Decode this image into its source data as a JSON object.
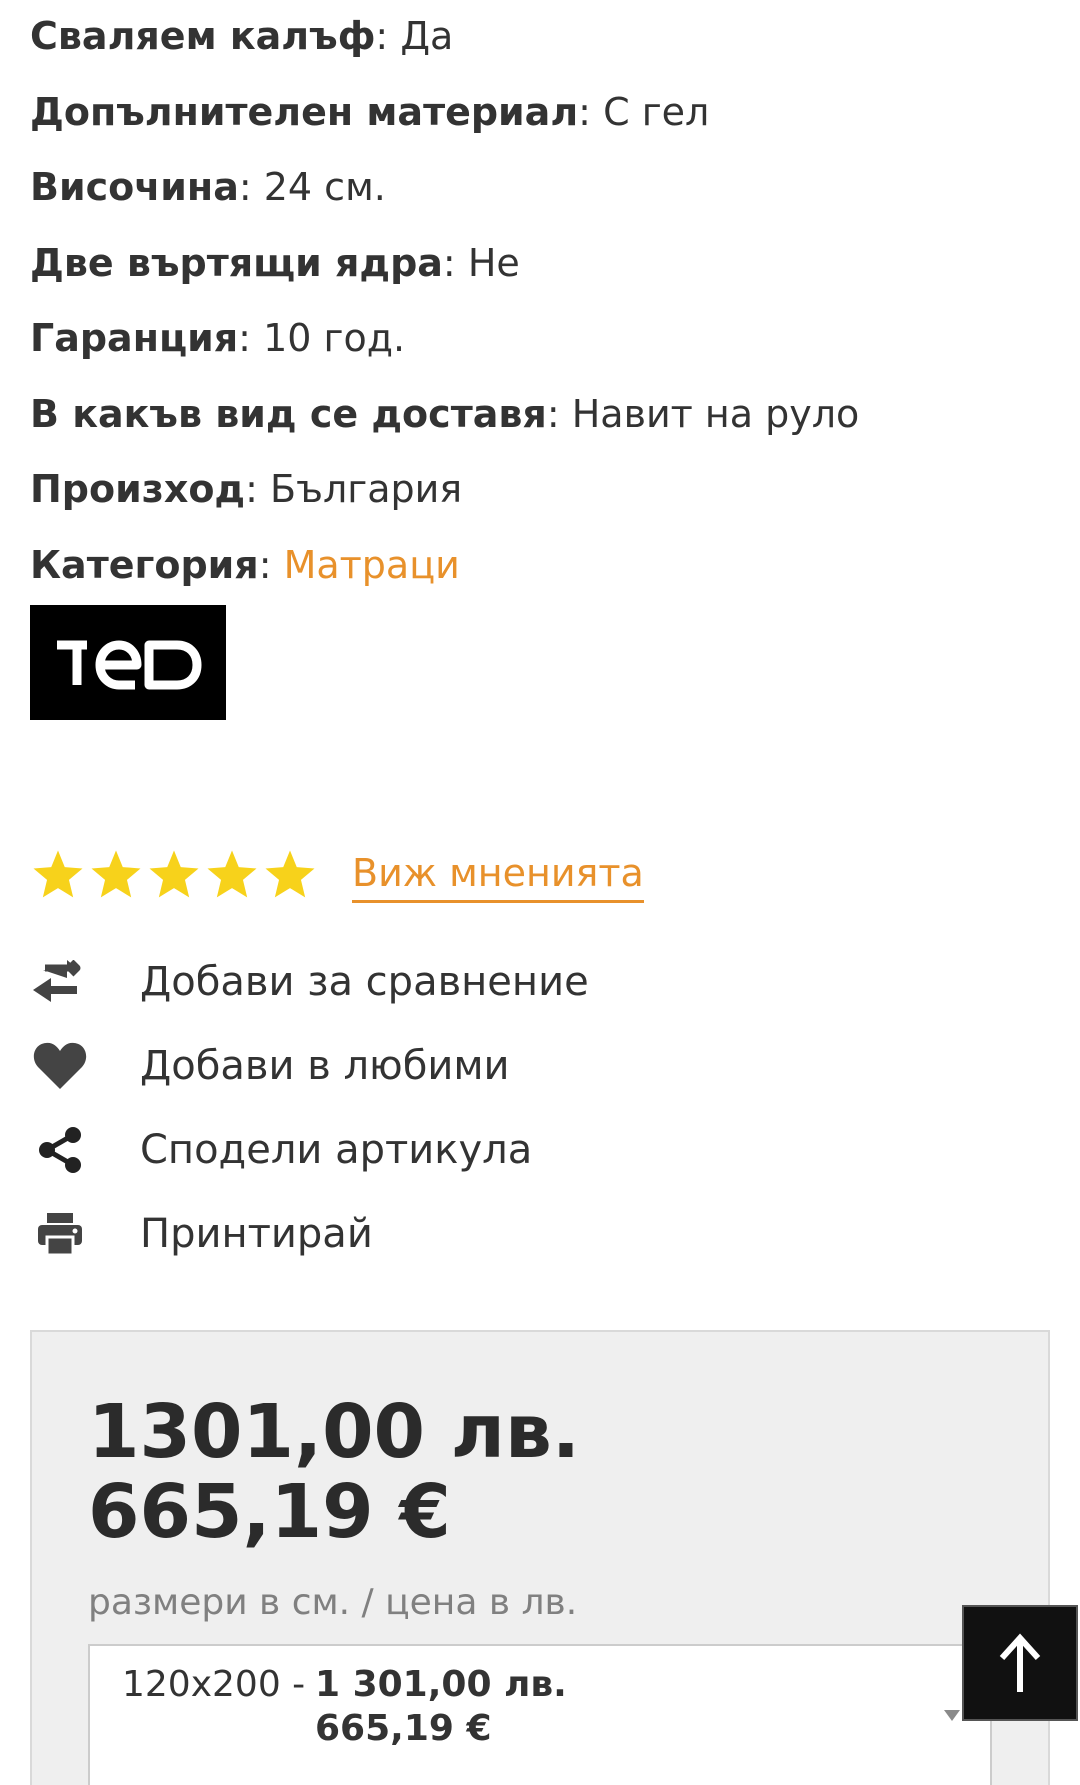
{
  "specs": [
    {
      "key": "Сваляем калъф",
      "sep": ":",
      "value": "Да"
    },
    {
      "key": "Допълнителен материал",
      "sep": ":",
      "value": "С гел"
    },
    {
      "key": "Височина",
      "sep": ":",
      "value": "24 см."
    },
    {
      "key": "Две въртящи ядра",
      "sep": ":",
      "value": "Не"
    },
    {
      "key": "Гаранция",
      "sep": ":",
      "value": "10 год."
    },
    {
      "key": "В какъв вид се доставя",
      "sep": ":",
      "value": "Навит на руло"
    },
    {
      "key": "Произход",
      "sep": ":",
      "value": "България"
    },
    {
      "key": "Категория",
      "sep": ":",
      "value": "Матраци"
    }
  ],
  "brand": {
    "logo_text": "TED",
    "icon": "brand-logo"
  },
  "rating": {
    "stars": 5,
    "max": 5,
    "reviews_link": "Виж мненията"
  },
  "actions": {
    "compare": {
      "label": "Добави за сравнение",
      "icon": "compare-arrows-icon"
    },
    "favorite": {
      "label": "Добави в любими",
      "icon": "heart-icon"
    },
    "share": {
      "label": "Сподели артикула",
      "icon": "share-icon"
    },
    "print": {
      "label": "Принтирай",
      "icon": "print-icon"
    }
  },
  "price": {
    "bgn": "1301,00 лв.",
    "eur": "665,19 €",
    "size_label": "размери в см. / цена в лв.",
    "selected_option": {
      "size": "120x200 -",
      "bgn": "1 301,00 лв.",
      "eur": "665,19 €"
    }
  },
  "colors": {
    "accent": "#e8912b",
    "star": "#f7d21b",
    "text": "#333333",
    "box_bg": "#efefef"
  },
  "back_to_top": {
    "icon": "arrow-up-icon"
  }
}
